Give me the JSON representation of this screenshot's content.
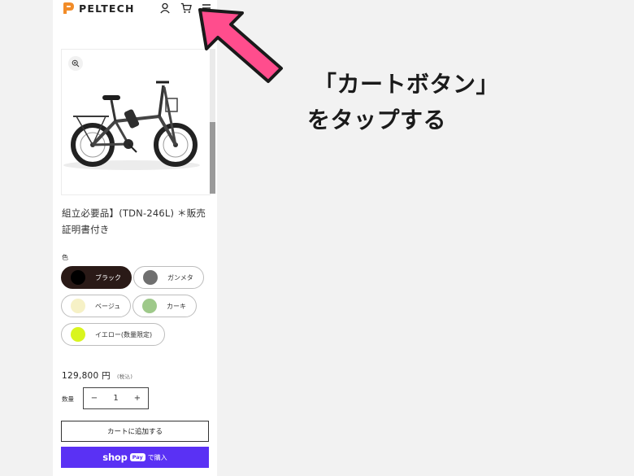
{
  "header": {
    "brand": "PELTECH",
    "icons": [
      "account-icon",
      "cart-icon",
      "menu-icon"
    ]
  },
  "gallery": {
    "zoom_icon": "zoom-in-icon",
    "image": "folding-e-bike-photo"
  },
  "product": {
    "title": "組立必要品】(TDN-246L) ＊販売証明書付き"
  },
  "variants": {
    "label": "色",
    "options": [
      {
        "label": "ブラック",
        "swatch": "#000000",
        "selected": true
      },
      {
        "label": "ガンメタ",
        "swatch": "#6f6f6f",
        "selected": false
      },
      {
        "label": "ベージュ",
        "swatch": "#f6f1c6",
        "selected": false
      },
      {
        "label": "カーキ",
        "swatch": "#9ec98a",
        "selected": false
      },
      {
        "label": "イエロー(数量限定)",
        "swatch": "#d9f51e",
        "selected": false
      }
    ]
  },
  "price": {
    "amount": "129,800 円",
    "tax_note": "(税込)"
  },
  "quantity": {
    "label": "数量",
    "minus": "−",
    "value": "1",
    "plus": "+"
  },
  "buttons": {
    "add_to_cart": "カートに追加する",
    "shop_word": "shop",
    "pay_badge": "Pay",
    "buy_label": "で購入"
  },
  "annotation": {
    "line1": "「カートボタン」",
    "line2": "をタップする",
    "arrow_color": "#ff4d8d"
  },
  "colors": {
    "selected_pill": "#2a1a17",
    "shop_pay": "#5a31f4",
    "logo_orange": "#f28c28"
  }
}
